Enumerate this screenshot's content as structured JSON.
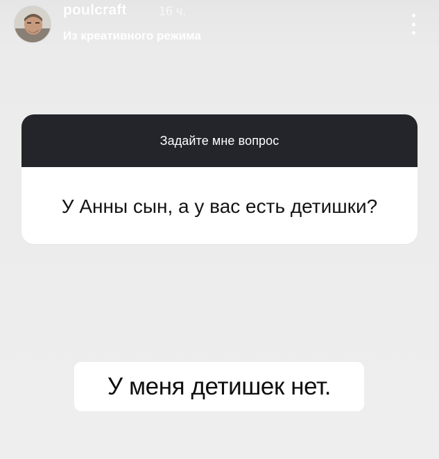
{
  "header": {
    "username": "poulcraft",
    "time": "16 ч.",
    "subtitle": "Из креативного режима",
    "more_icon": "more-vertical-icon"
  },
  "question_sticker": {
    "title": "Задайте мне вопрос",
    "question": "У Анны сын, а у вас есть детишки?"
  },
  "answer": {
    "text": "У меня детишек нет."
  },
  "colors": {
    "background": "#ececec",
    "sticker_header": "#23252b",
    "card": "#ffffff",
    "header_text": "#ffffff"
  }
}
